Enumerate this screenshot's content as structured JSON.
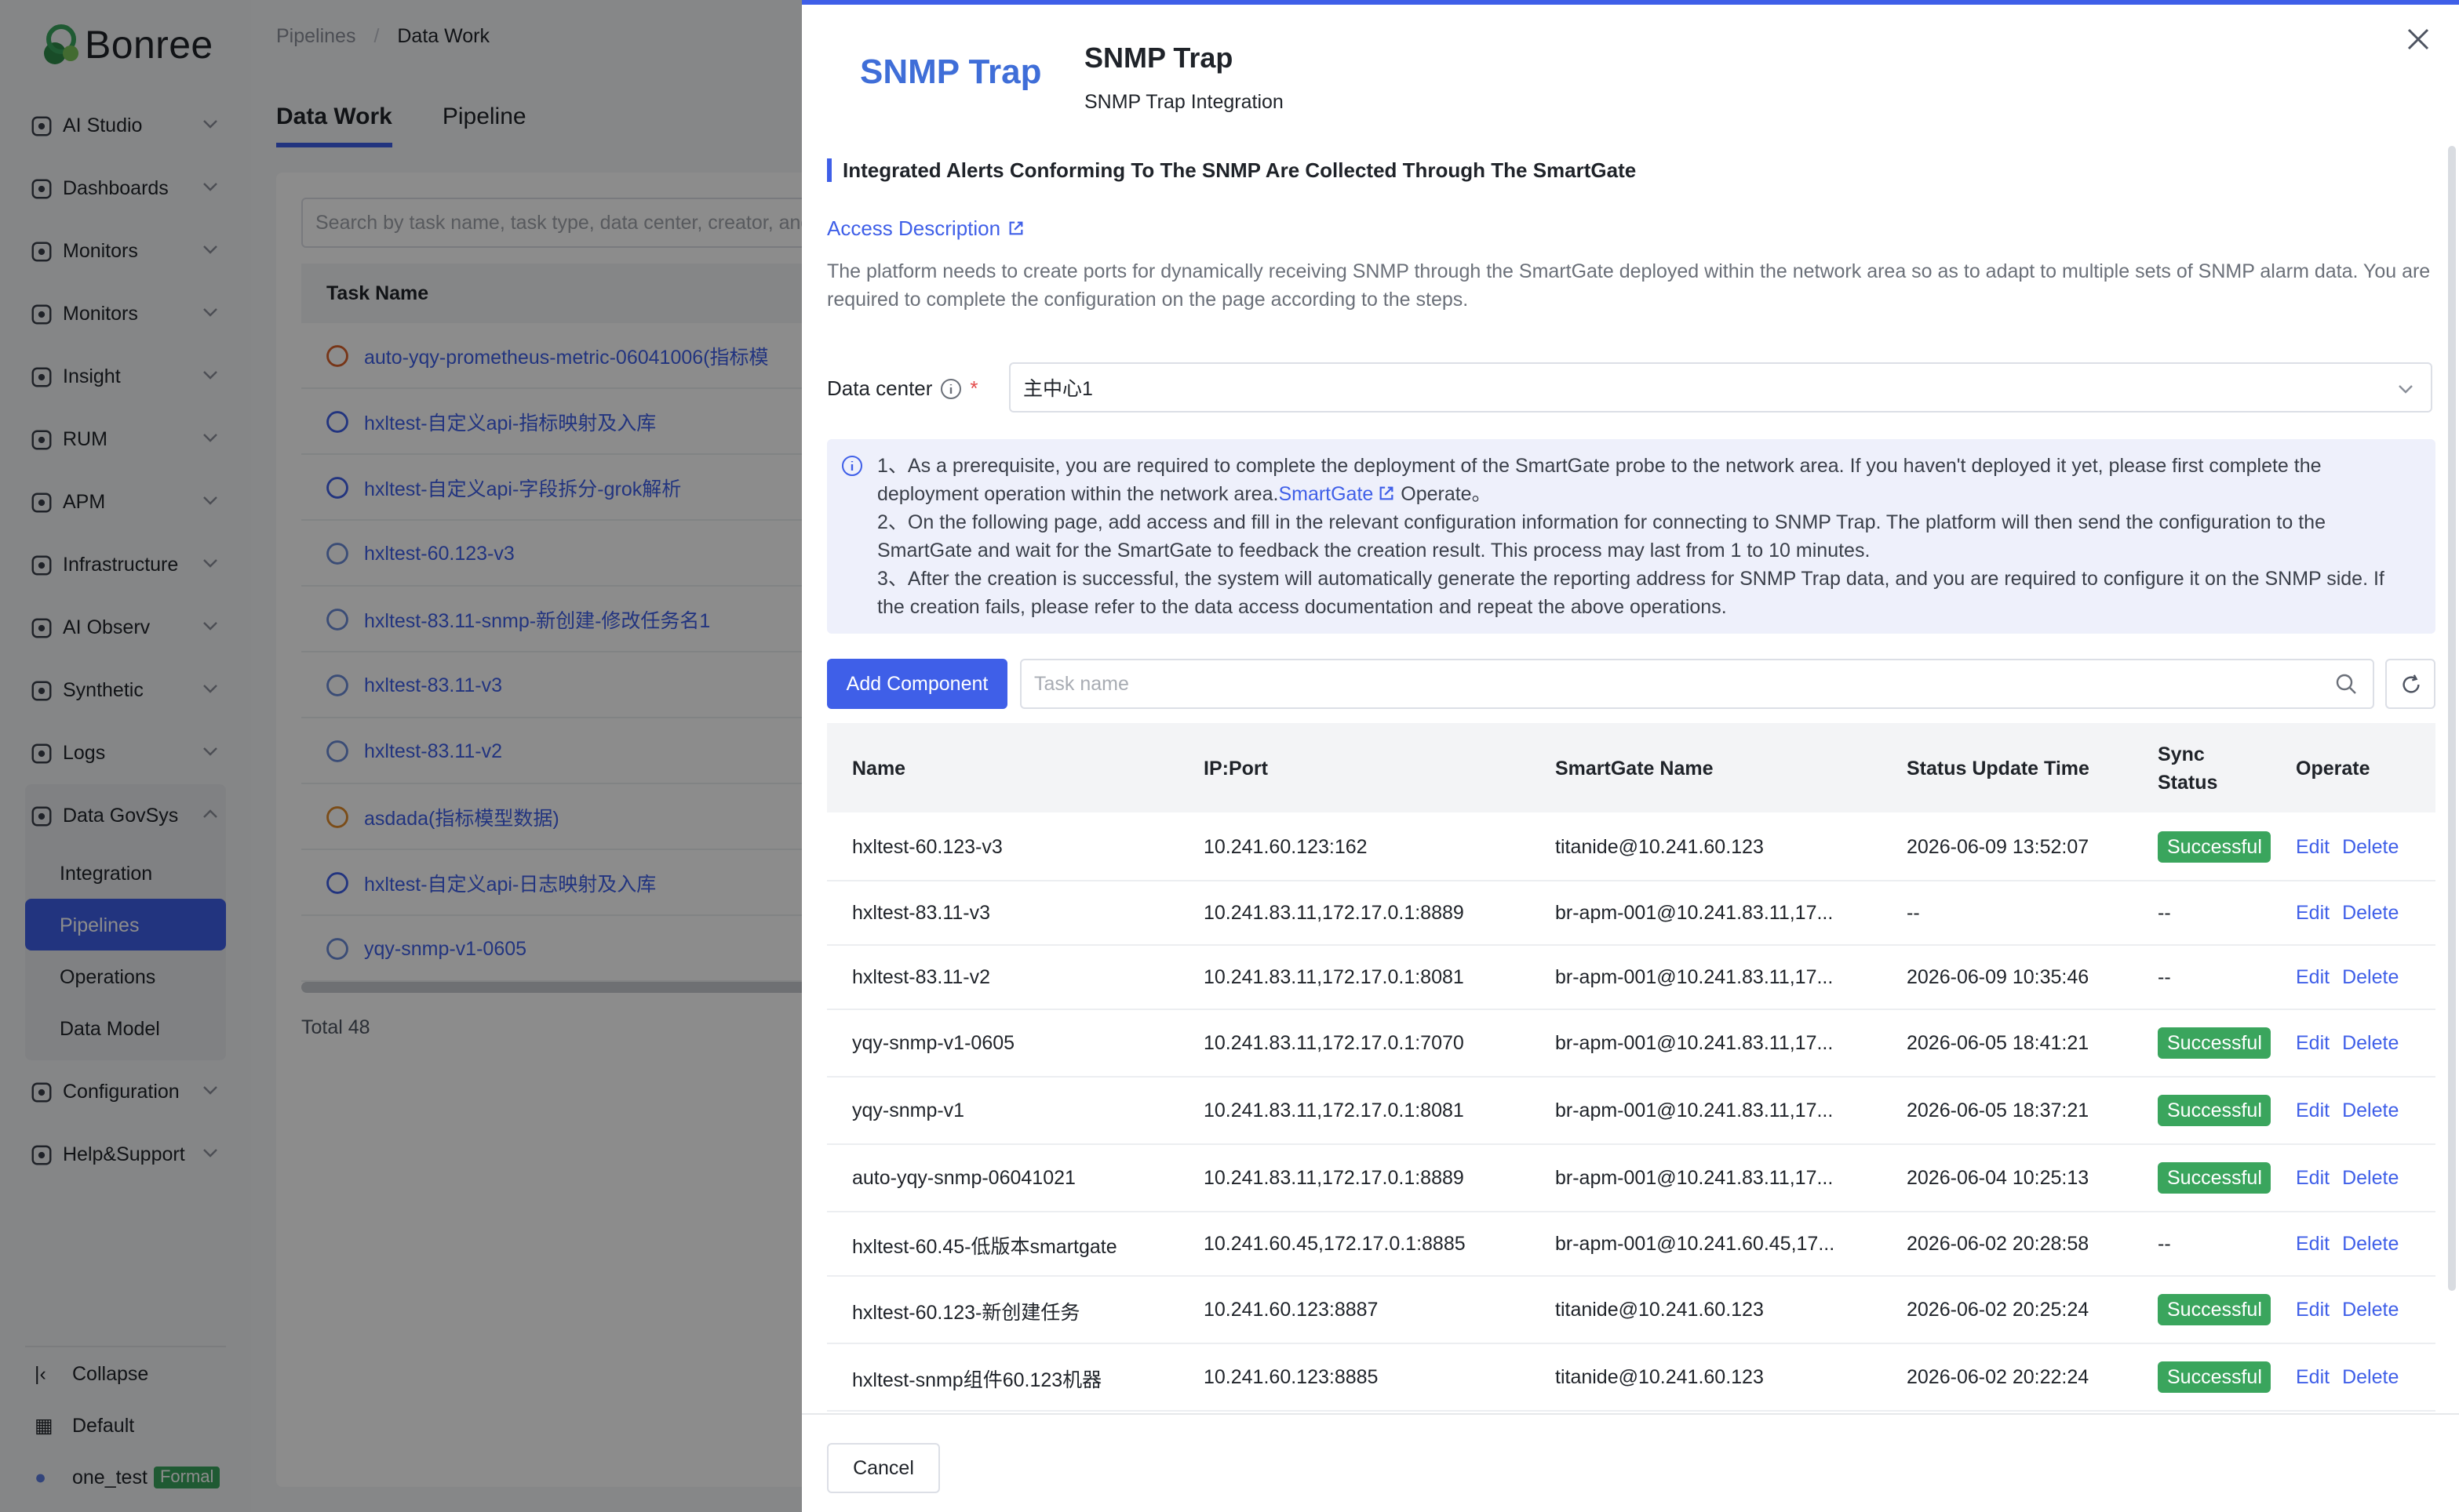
{
  "app": {
    "logo": "Bonree"
  },
  "sidebar": {
    "items": [
      {
        "label": "AI Studio",
        "icon": "ai-studio-icon"
      },
      {
        "label": "Dashboards",
        "icon": "dashboard-icon"
      },
      {
        "label": "Monitors",
        "icon": "monitor-icon"
      },
      {
        "label": "Monitors",
        "icon": "monitor-icon"
      },
      {
        "label": "Insight",
        "icon": "insight-icon"
      },
      {
        "label": "RUM",
        "icon": "rum-icon"
      },
      {
        "label": "APM",
        "icon": "apm-icon"
      },
      {
        "label": "Infrastructure",
        "icon": "infrastructure-icon"
      },
      {
        "label": "AI Observ",
        "icon": "ai-observ-icon"
      },
      {
        "label": "Synthetic",
        "icon": "synthetic-icon"
      },
      {
        "label": "Logs",
        "icon": "logs-icon"
      }
    ],
    "group": {
      "label": "Data GovSys",
      "children": [
        "Integration",
        "Pipelines",
        "Operations",
        "Data Model"
      ],
      "active": "Pipelines"
    },
    "after": [
      {
        "label": "Configuration"
      },
      {
        "label": "Help&Support"
      }
    ],
    "bottom": {
      "collapse": "Collapse",
      "default": "Default",
      "user": "one_test",
      "user_badge": "Formal"
    }
  },
  "background": {
    "breadcrumb": [
      "Pipelines",
      "Data Work"
    ],
    "tabs": [
      "Data Work",
      "Pipeline"
    ],
    "search_placeholder": "Search by task name, task type, data center, creator, and",
    "column": "Task Name",
    "rows": [
      "auto-yqy-prometheus-metric-06041006(指标模",
      "hxltest-自定义api-指标映射及入库",
      "hxltest-自定义api-字段拆分-grok解析",
      "hxltest-60.123-v3",
      "hxltest-83.11-snmp-新创建-修改任务名1",
      "hxltest-83.11-v3",
      "hxltest-83.11-v2",
      "asdada(指标模型数据)",
      "hxltest-自定义api-日志映射及入库",
      "yqy-snmp-v1-0605"
    ],
    "total": "Total 48"
  },
  "drawer": {
    "brand_logo": "SNMP Trap",
    "title": "SNMP Trap",
    "subtitle": "SNMP Trap Integration",
    "section_title": "Integrated Alerts Conforming To The SNMP Are Collected Through The SmartGate",
    "access_link": "Access Description",
    "description": "The platform needs to create ports for dynamically receiving SNMP through the SmartGate deployed within the network area so as to adapt to multiple sets of SNMP alarm data. You are required to complete the configuration on the page according to the steps.",
    "data_center_label": "Data center",
    "data_center_value": "主中心1",
    "info": {
      "line1_a": "1、As a prerequisite, you are required to complete the deployment of the SmartGate probe to the network area. If you haven't deployed it yet, please first complete the deployment operation within the network area.",
      "line1_link": "SmartGate",
      "line1_b": " Operate。",
      "line2": "2、On the following page, add access and fill in the relevant configuration information for connecting to SNMP Trap. The platform will then send the configuration to the SmartGate and wait for the SmartGate to feedback the creation result. This process may last from 1 to 10 minutes.",
      "line3": "3、After the creation is successful, the system will automatically generate the reporting address for SNMP Trap data, and you are required to configure it on the SNMP side. If the creation fails, please refer to the data access documentation and repeat the above operations."
    },
    "add_button": "Add Component",
    "task_placeholder": "Task name",
    "columns": [
      "Name",
      "IP:Port",
      "SmartGate Name",
      "Status Update Time",
      "Sync Status",
      "Operate"
    ],
    "edit_label": "Edit",
    "delete_label": "Delete",
    "rows": [
      {
        "name": "hxltest-60.123-v3",
        "ip": "10.241.60.123:162",
        "sg": "titanide@10.241.60.123",
        "time": "2026-06-09 13:52:07",
        "sync": "Successful"
      },
      {
        "name": "hxltest-83.11-v3",
        "ip": "10.241.83.11,172.17.0.1:8889",
        "sg": "br-apm-001@10.241.83.11,17...",
        "time": "--",
        "sync": "--"
      },
      {
        "name": "hxltest-83.11-v2",
        "ip": "10.241.83.11,172.17.0.1:8081",
        "sg": "br-apm-001@10.241.83.11,17...",
        "time": "2026-06-09 10:35:46",
        "sync": "--"
      },
      {
        "name": "yqy-snmp-v1-0605",
        "ip": "10.241.83.11,172.17.0.1:7070",
        "sg": "br-apm-001@10.241.83.11,17...",
        "time": "2026-06-05 18:41:21",
        "sync": "Successful"
      },
      {
        "name": "yqy-snmp-v1",
        "ip": "10.241.83.11,172.17.0.1:8081",
        "sg": "br-apm-001@10.241.83.11,17...",
        "time": "2026-06-05 18:37:21",
        "sync": "Successful"
      },
      {
        "name": "auto-yqy-snmp-06041021",
        "ip": "10.241.83.11,172.17.0.1:8889",
        "sg": "br-apm-001@10.241.83.11,17...",
        "time": "2026-06-04 10:25:13",
        "sync": "Successful"
      },
      {
        "name": "hxltest-60.45-低版本smartgate",
        "ip": "10.241.60.45,172.17.0.1:8885",
        "sg": "br-apm-001@10.241.60.45,17...",
        "time": "2026-06-02 20:28:58",
        "sync": "--"
      },
      {
        "name": "hxltest-60.123-新创建任务",
        "ip": "10.241.60.123:8887",
        "sg": "titanide@10.241.60.123",
        "time": "2026-06-02 20:25:24",
        "sync": "Successful"
      },
      {
        "name": "hxltest-snmp组件60.123机器",
        "ip": "10.241.60.123:8885",
        "sg": "titanide@10.241.60.123",
        "time": "2026-06-02 20:22:24",
        "sync": "Successful"
      }
    ],
    "cancel": "Cancel"
  },
  "colors": {
    "accent": "#3f5fe8",
    "success": "#3aa55d",
    "overlay": "rgba(0,0,0,0.45)"
  }
}
